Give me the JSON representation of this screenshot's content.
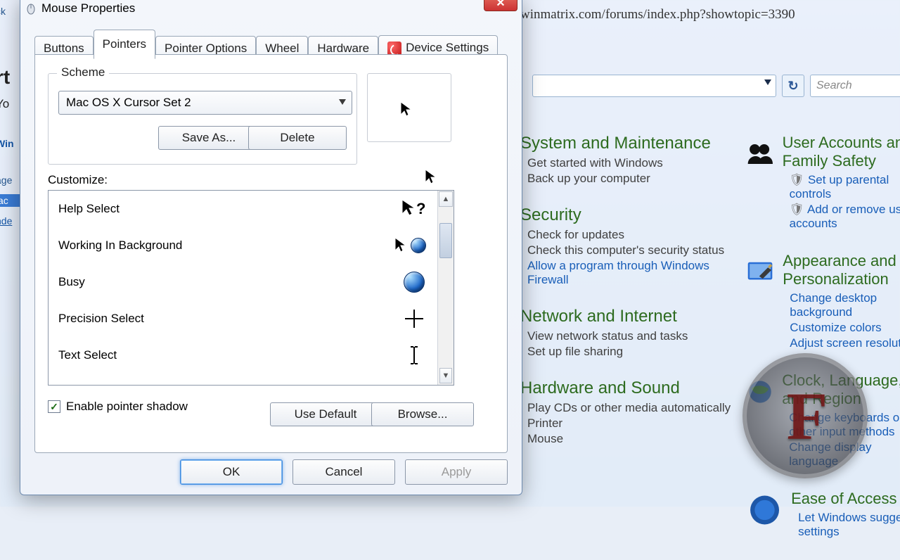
{
  "browser": {
    "url_fragment": "winmatrix.com/forums/index.php?showtopic=3390",
    "search_placeholder": "Search"
  },
  "control_panel": {
    "col1": [
      {
        "head": "System and Maintenance",
        "links": [
          "Get started with Windows",
          "Back up your computer"
        ]
      },
      {
        "head": "Security",
        "links": [
          "Check for updates",
          "Check this computer's security status",
          "Allow a program through Windows Firewall"
        ]
      },
      {
        "head": "Network and Internet",
        "links": [
          "View network status and tasks",
          "Set up file sharing"
        ]
      },
      {
        "head": "Hardware and Sound",
        "links": [
          "Play CDs or other media automatically",
          "Printer",
          "Mouse"
        ]
      }
    ],
    "col2": [
      {
        "head": "User Accounts and Family Safety",
        "links": [
          "Set up parental controls",
          "Add or remove user accounts"
        ]
      },
      {
        "head": "Appearance and Personalization",
        "links": [
          "Change desktop background",
          "Customize colors",
          "Adjust screen resolution"
        ]
      },
      {
        "head": "Clock, Language, and Region",
        "links": [
          "Change keyboards or other input methods",
          "Change display language"
        ]
      },
      {
        "head": "Ease of Access",
        "links": [
          "Let Windows suggest settings"
        ]
      }
    ]
  },
  "dialog": {
    "title": "Mouse Properties",
    "tabs": [
      "Buttons",
      "Pointers",
      "Pointer Options",
      "Wheel",
      "Hardware",
      "Device Settings"
    ],
    "active_tab": "Pointers",
    "scheme_label": "Scheme",
    "scheme_value": "Mac OS X Cursor Set 2",
    "save_as": "Save As...",
    "delete": "Delete",
    "customize_label": "Customize:",
    "cursors": [
      {
        "name": "Help Select",
        "icon": "help"
      },
      {
        "name": "Working In Background",
        "icon": "arrow-orb"
      },
      {
        "name": "Busy",
        "icon": "orb"
      },
      {
        "name": "Precision Select",
        "icon": "cross"
      },
      {
        "name": "Text Select",
        "icon": "ibeam"
      }
    ],
    "enable_shadow": "Enable pointer shadow",
    "shadow_checked": true,
    "use_default": "Use Default",
    "browse": "Browse...",
    "ok": "OK",
    "cancel": "Cancel",
    "apply": "Apply"
  },
  "watermark_text": "F",
  "colors": {
    "link": "#195eb8",
    "heading": "#2d6b1f",
    "accent": "#3e8adf"
  }
}
